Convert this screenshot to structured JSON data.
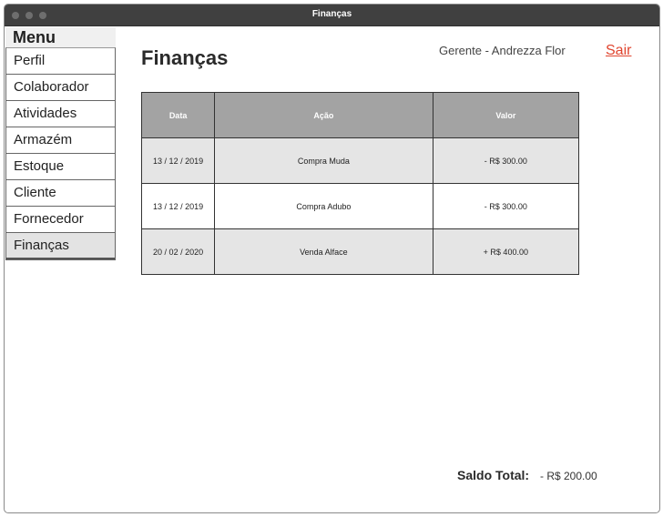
{
  "window": {
    "title": "Finanças"
  },
  "sidebar": {
    "header": "Menu",
    "items": [
      {
        "label": "Perfil",
        "active": false
      },
      {
        "label": "Colaborador",
        "active": false
      },
      {
        "label": "Atividades",
        "active": false
      },
      {
        "label": "Armazém",
        "active": false
      },
      {
        "label": "Estoque",
        "active": false
      },
      {
        "label": "Cliente",
        "active": false
      },
      {
        "label": "Fornecedor",
        "active": false
      },
      {
        "label": "Finanças",
        "active": true
      }
    ]
  },
  "header": {
    "title": "Finanças",
    "user": "Gerente - Andrezza Flor",
    "logout_label": "Sair",
    "logout_color": "#e0452f"
  },
  "table": {
    "columns": [
      "Data",
      "Ação",
      "Valor"
    ],
    "rows": [
      {
        "date": "13 / 12 / 2019",
        "action": "Compra Muda",
        "value": "- R$ 300.00"
      },
      {
        "date": "13 / 12 / 2019",
        "action": "Compra Adubo",
        "value": "- R$ 300.00"
      },
      {
        "date": "20 / 02 / 2020",
        "action": "Venda Alface",
        "value": "+ R$ 400.00"
      }
    ]
  },
  "footer": {
    "saldo_label": "Saldo Total:",
    "saldo_value": "- R$ 200.00"
  }
}
